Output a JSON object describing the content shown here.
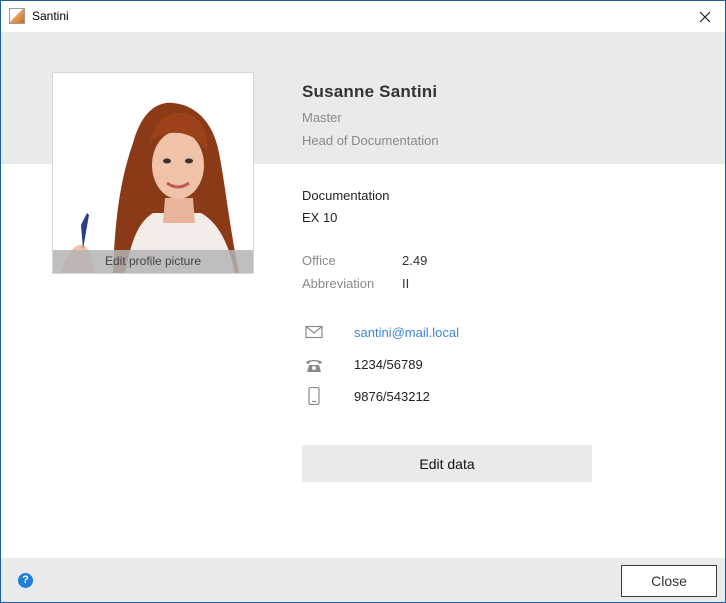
{
  "window": {
    "title": "Santini",
    "close_icon": "close-icon"
  },
  "profile": {
    "photo_caption": "Edit profile picture",
    "name": "Susanne Santini",
    "role": "Master",
    "position": "Head of Documentation",
    "department": "Documentation",
    "unit": "EX 10",
    "details": [
      {
        "label": "Office",
        "value": "2.49"
      },
      {
        "label": "Abbreviation",
        "value": "II"
      }
    ],
    "contacts": [
      {
        "icon": "mail-icon",
        "value": "santini@mail.local"
      },
      {
        "icon": "phone-icon",
        "value": "1234/56789"
      },
      {
        "icon": "mobile-icon",
        "value": "9876/543212"
      }
    ],
    "edit_button": "Edit data"
  },
  "footer": {
    "help_icon": "help-icon",
    "help_glyph": "?",
    "close_button": "Close"
  },
  "colors": {
    "band": "#e9eaeb",
    "link": "#3d87d6",
    "help": "#1f7fd8",
    "border": "#1d5fa8"
  }
}
